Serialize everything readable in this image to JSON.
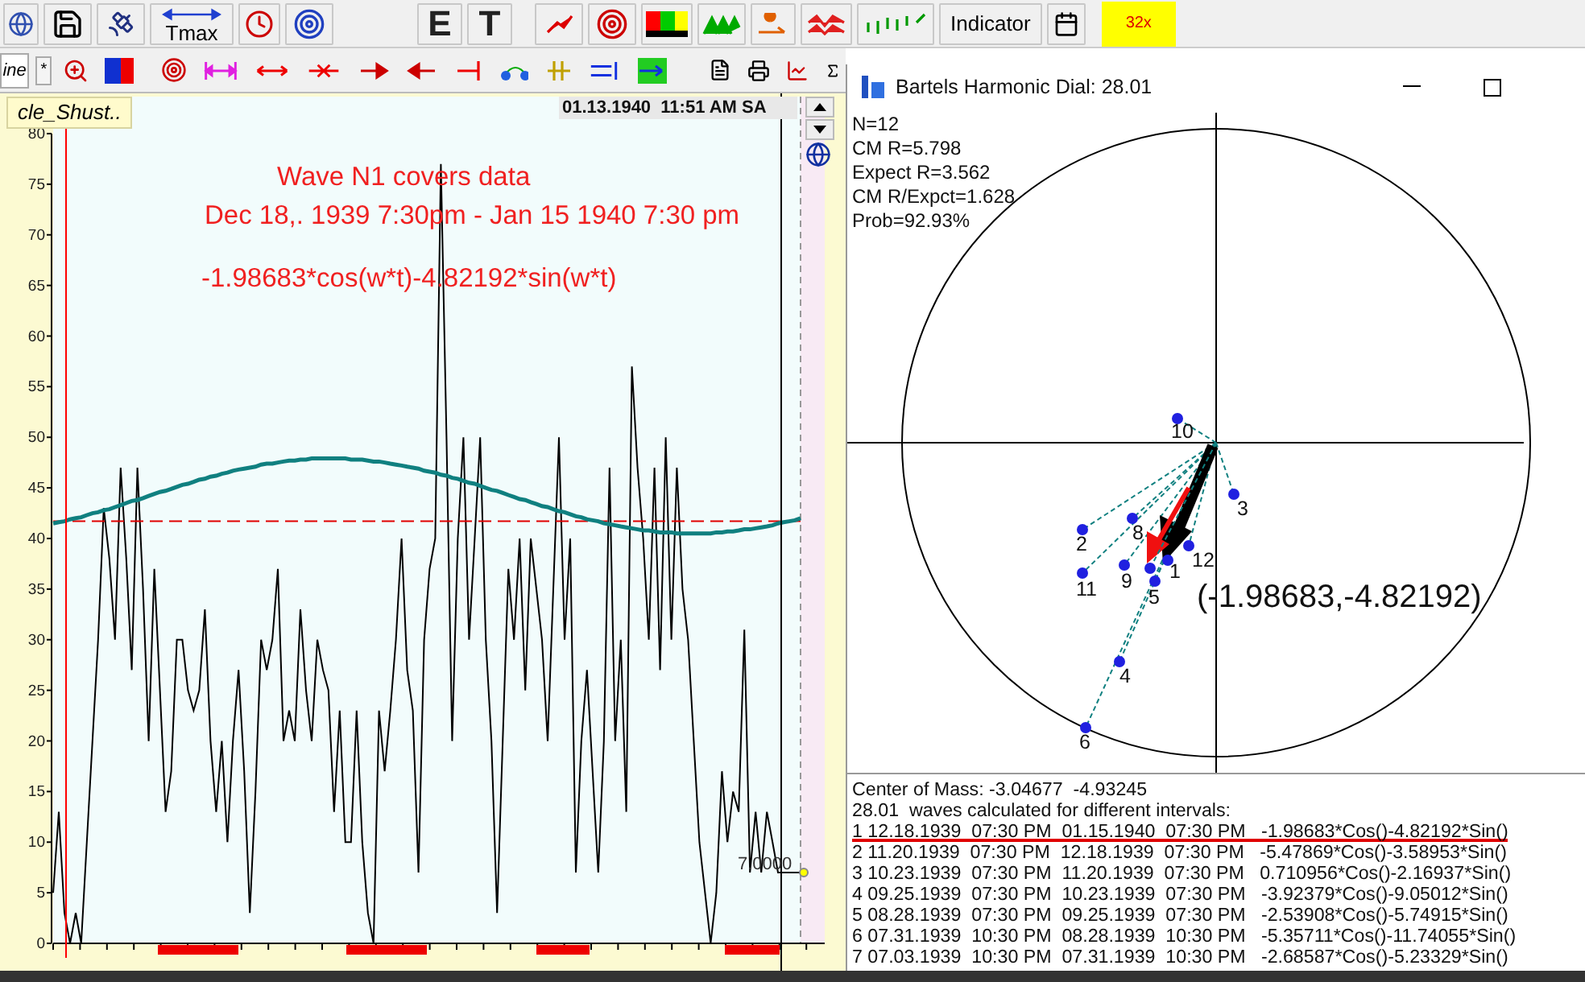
{
  "toolbar": {
    "row1": {
      "tmax": "Tmax",
      "e": "E",
      "t": "T",
      "indicator": "Indicator",
      "zoom_factor": "32x"
    },
    "row2": {
      "tab_fragment": "ine",
      "star": "*"
    }
  },
  "chart_panel": {
    "tab": "cle_Shust..",
    "datetime": "01.13.1940  11:51 AM SA",
    "cursor_value": "7.0000",
    "chart_data": {
      "type": "line",
      "ylim": [
        0,
        80
      ],
      "yticks": [
        0,
        5,
        10,
        15,
        20,
        25,
        30,
        35,
        40,
        45,
        50,
        55,
        60,
        65,
        70,
        75,
        80
      ],
      "series": [
        {
          "color": "#000000",
          "values": [
            5,
            13,
            3,
            0,
            3,
            0,
            10,
            20,
            30,
            43,
            38,
            30,
            47,
            38,
            27,
            47,
            35,
            20,
            37,
            25,
            13,
            17,
            30,
            30,
            25,
            23,
            25,
            33,
            20,
            13,
            20,
            10,
            20,
            27,
            17,
            3,
            15,
            30,
            27,
            30,
            37,
            20,
            23,
            20,
            33,
            25,
            20,
            30,
            27,
            25,
            13,
            23,
            10,
            10,
            23,
            10,
            3,
            0,
            23,
            17,
            23,
            30,
            40,
            27,
            23,
            7,
            30,
            37,
            40,
            77,
            50,
            20,
            40,
            50,
            30,
            40,
            50,
            30,
            20,
            3,
            20,
            37,
            30,
            40,
            25,
            40,
            35,
            30,
            20,
            35,
            50,
            30,
            40,
            7,
            20,
            27,
            17,
            7,
            20,
            47,
            20,
            30,
            13,
            57,
            47,
            40,
            30,
            47,
            27,
            50,
            30,
            47,
            35,
            30,
            20,
            10,
            5,
            0,
            5,
            17,
            10,
            15,
            13,
            31,
            7,
            13,
            7,
            13,
            10,
            7,
            7,
            7,
            7,
            7
          ]
        },
        {
          "color": "#108080",
          "values": [
            41.5,
            41.6,
            41.7,
            41.9,
            42.0,
            42.1,
            42.3,
            42.5,
            42.6,
            42.8,
            42.9,
            43.1,
            43.3,
            43.5,
            43.7,
            43.8,
            44.0,
            44.2,
            44.4,
            44.6,
            44.7,
            44.9,
            45.1,
            45.3,
            45.4,
            45.6,
            45.8,
            45.9,
            46.1,
            46.2,
            46.4,
            46.5,
            46.7,
            46.8,
            46.9,
            47.0,
            47.1,
            47.3,
            47.4,
            47.4,
            47.5,
            47.6,
            47.7,
            47.7,
            47.8,
            47.8,
            47.9,
            47.9,
            47.9,
            47.9,
            47.9,
            47.9,
            47.9,
            47.8,
            47.8,
            47.8,
            47.7,
            47.6,
            47.6,
            47.5,
            47.4,
            47.3,
            47.2,
            47.1,
            47.0,
            46.9,
            46.7,
            46.6,
            46.5,
            46.3,
            46.2,
            46.0,
            45.9,
            45.7,
            45.5,
            45.4,
            45.2,
            45.0,
            44.8,
            44.7,
            44.5,
            44.3,
            44.1,
            43.9,
            43.8,
            43.6,
            43.4,
            43.2,
            43.1,
            42.9,
            42.7,
            42.6,
            42.4,
            42.2,
            42.1,
            41.9,
            41.8,
            41.7,
            41.5,
            41.4,
            41.3,
            41.2,
            41.1,
            41.0,
            40.9,
            40.8,
            40.8,
            40.7,
            40.6,
            40.6,
            40.6,
            40.5,
            40.5,
            40.5,
            40.5,
            40.5,
            40.5,
            40.5,
            40.6,
            40.6,
            40.7,
            40.7,
            40.8,
            40.9,
            40.9,
            41.0,
            41.1,
            41.2,
            41.3,
            41.5,
            41.6,
            41.7,
            41.8,
            42.0
          ]
        },
        {
          "color": "#e00000",
          "line_style": "dashed",
          "values": [
            41.7,
            41.7,
            41.7,
            41.7,
            41.7,
            41.7,
            41.7,
            41.7,
            41.7,
            41.7,
            41.7,
            41.7,
            41.7,
            41.7,
            41.7,
            41.7,
            41.7,
            41.7,
            41.7,
            41.7,
            41.7,
            41.7,
            41.7,
            41.7,
            41.7,
            41.7,
            41.7,
            41.7,
            41.7,
            41.7,
            41.7,
            41.7,
            41.7,
            41.7,
            41.7,
            41.7,
            41.7,
            41.7,
            41.7,
            41.7,
            41.7,
            41.7,
            41.7,
            41.7,
            41.7,
            41.7,
            41.7,
            41.7,
            41.7,
            41.7,
            41.7,
            41.7,
            41.7,
            41.7,
            41.7,
            41.7,
            41.7,
            41.7,
            41.7,
            41.7,
            41.7,
            41.7,
            41.7,
            41.7,
            41.7,
            41.7,
            41.7,
            41.7,
            41.7,
            41.7,
            41.7,
            41.7,
            41.7,
            41.7,
            41.7,
            41.7,
            41.7,
            41.7,
            41.7,
            41.7,
            41.7,
            41.7,
            41.7,
            41.7,
            41.7,
            41.7,
            41.7,
            41.7,
            41.7,
            41.7,
            41.7,
            41.7,
            41.7,
            41.7,
            41.7,
            41.7,
            41.7,
            41.7,
            41.7,
            41.7,
            41.7,
            41.7,
            41.7,
            41.7,
            41.7,
            41.7,
            41.7,
            41.7,
            41.7,
            41.7,
            41.7,
            41.7,
            41.7,
            41.7,
            41.7,
            41.7,
            41.7,
            41.7,
            41.7,
            41.7,
            41.7,
            41.7,
            41.7,
            41.7,
            41.7,
            41.7,
            41.7,
            41.7,
            41.7,
            41.7,
            41.7,
            41.7,
            41.7,
            41.7
          ]
        }
      ],
      "annotations": [
        "Wave N1 covers data",
        "Dec 18,. 1939 7:30pm - Jan 15 1940 7:30 pm",
        "-1.98683*cos(w*t)-4.82192*sin(w*t)"
      ]
    }
  },
  "dial_window": {
    "title": "Bartels Harmonic Dial: 28.01",
    "stats": [
      "N=12",
      "CM R=5.798",
      "Expect R=3.562",
      "CM R/Expct=1.628",
      "Prob=92.93%"
    ],
    "points": [
      {
        "label": "1"
      },
      {
        "label": "2"
      },
      {
        "label": "3"
      },
      {
        "label": "4"
      },
      {
        "label": "5"
      },
      {
        "label": "6"
      },
      {
        "label": "8"
      },
      {
        "label": "9"
      },
      {
        "label": "10"
      },
      {
        "label": "11"
      },
      {
        "label": "12"
      }
    ],
    "vector_label": "(-1.98683,-4.82192)",
    "center_of_mass": "Center of Mass: -3.04677  -4.93245",
    "summary": "28.01  waves calculated for different intervals:",
    "rows": [
      {
        "text": "1 12.18.1939  07:30 PM  01.15.1940  07:30 PM   -1.98683*Cos()-4.82192*Sin()",
        "selected": true
      },
      {
        "text": "2 11.20.1939  07:30 PM  12.18.1939  07:30 PM   -5.47869*Cos()-3.58953*Sin()",
        "selected": false
      },
      {
        "text": "3 10.23.1939  07:30 PM  11.20.1939  07:30 PM   0.710956*Cos()-2.16937*Sin()",
        "selected": false
      },
      {
        "text": "4 09.25.1939  07:30 PM  10.23.1939  07:30 PM   -3.92379*Cos()-9.05012*Sin()",
        "selected": false
      },
      {
        "text": "5 08.28.1939  07:30 PM  09.25.1939  07:30 PM   -2.53908*Cos()-5.74915*Sin()",
        "selected": false
      },
      {
        "text": "6 07.31.1939  10:30 PM  08.28.1939  10:30 PM   -5.35711*Cos()-11.74055*Sin()",
        "selected": false
      },
      {
        "text": "7 07.03.1939  10:30 PM  07.31.1939  10:30 PM   -2.68587*Cos()-5.23329*Sin()",
        "selected": false
      }
    ]
  }
}
